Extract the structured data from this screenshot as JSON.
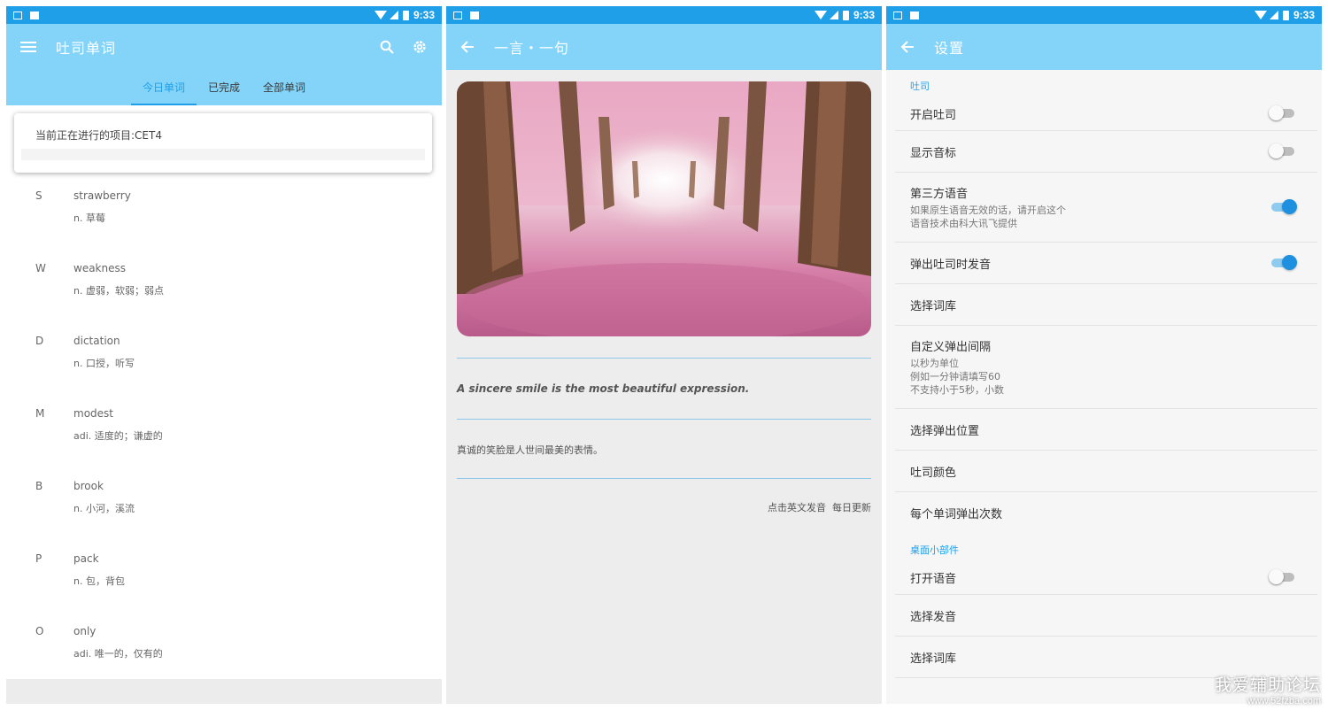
{
  "status_bar": {
    "time": "9:33"
  },
  "panel1": {
    "app_title": "吐司单词",
    "tabs": [
      "今日单词",
      "已完成",
      "全部单词"
    ],
    "active_tab": 0,
    "project_text": "当前正在进行的项目:CET4",
    "words": [
      {
        "letter": "S",
        "en": "strawberry",
        "zh": "n. 草莓"
      },
      {
        "letter": "W",
        "en": "weakness",
        "zh": "n. 虚弱，软弱；弱点"
      },
      {
        "letter": "D",
        "en": "dictation",
        "zh": "n. 口授，听写"
      },
      {
        "letter": "M",
        "en": "modest",
        "zh": "adi. 适度的；谦虚的"
      },
      {
        "letter": "B",
        "en": "brook",
        "zh": "n. 小河，溪流"
      },
      {
        "letter": "P",
        "en": "pack",
        "zh": "n. 包，背包"
      },
      {
        "letter": "O",
        "en": "only",
        "zh": "adi. 唯一的，仅有的"
      }
    ]
  },
  "panel2": {
    "title": "一言・一句",
    "quote_en": "A sincere smile is the most beautiful expression.",
    "quote_zh": "真诚的笑脸是人世间最美的表情。",
    "footer": [
      "点击英文发音",
      "每日更新"
    ]
  },
  "panel3": {
    "title": "设置",
    "sections": [
      {
        "header": "吐司",
        "items": [
          {
            "label": "开启吐司",
            "toggle": false
          },
          {
            "label": "显示音标",
            "toggle": false
          },
          {
            "label": "第三方语音",
            "sub": [
              "如果原生语音无效的话，请开启这个",
              "语音技术由科大讯飞提供"
            ],
            "toggle": true
          },
          {
            "label": "弹出吐司时发音",
            "toggle": true
          },
          {
            "label": "选择词库"
          },
          {
            "label": "自定义弹出间隔",
            "sub": [
              "以秒为单位",
              "例如一分钟请填写60",
              "不支持小于5秒，小数"
            ]
          },
          {
            "label": "选择弹出位置"
          },
          {
            "label": "吐司颜色"
          },
          {
            "label": "每个单词弹出次数"
          }
        ]
      },
      {
        "header": "桌面小部件",
        "items": [
          {
            "label": "打开语音",
            "toggle": false
          },
          {
            "label": "选择发音"
          },
          {
            "label": "选择词库"
          }
        ]
      }
    ]
  },
  "watermark": {
    "line1": "我爱辅助论坛",
    "line2": "www.52fzba.com"
  },
  "colors": {
    "appbar": "#84d3f8",
    "statusbar": "#1f9fe8",
    "accent": "#1f9fe8"
  }
}
